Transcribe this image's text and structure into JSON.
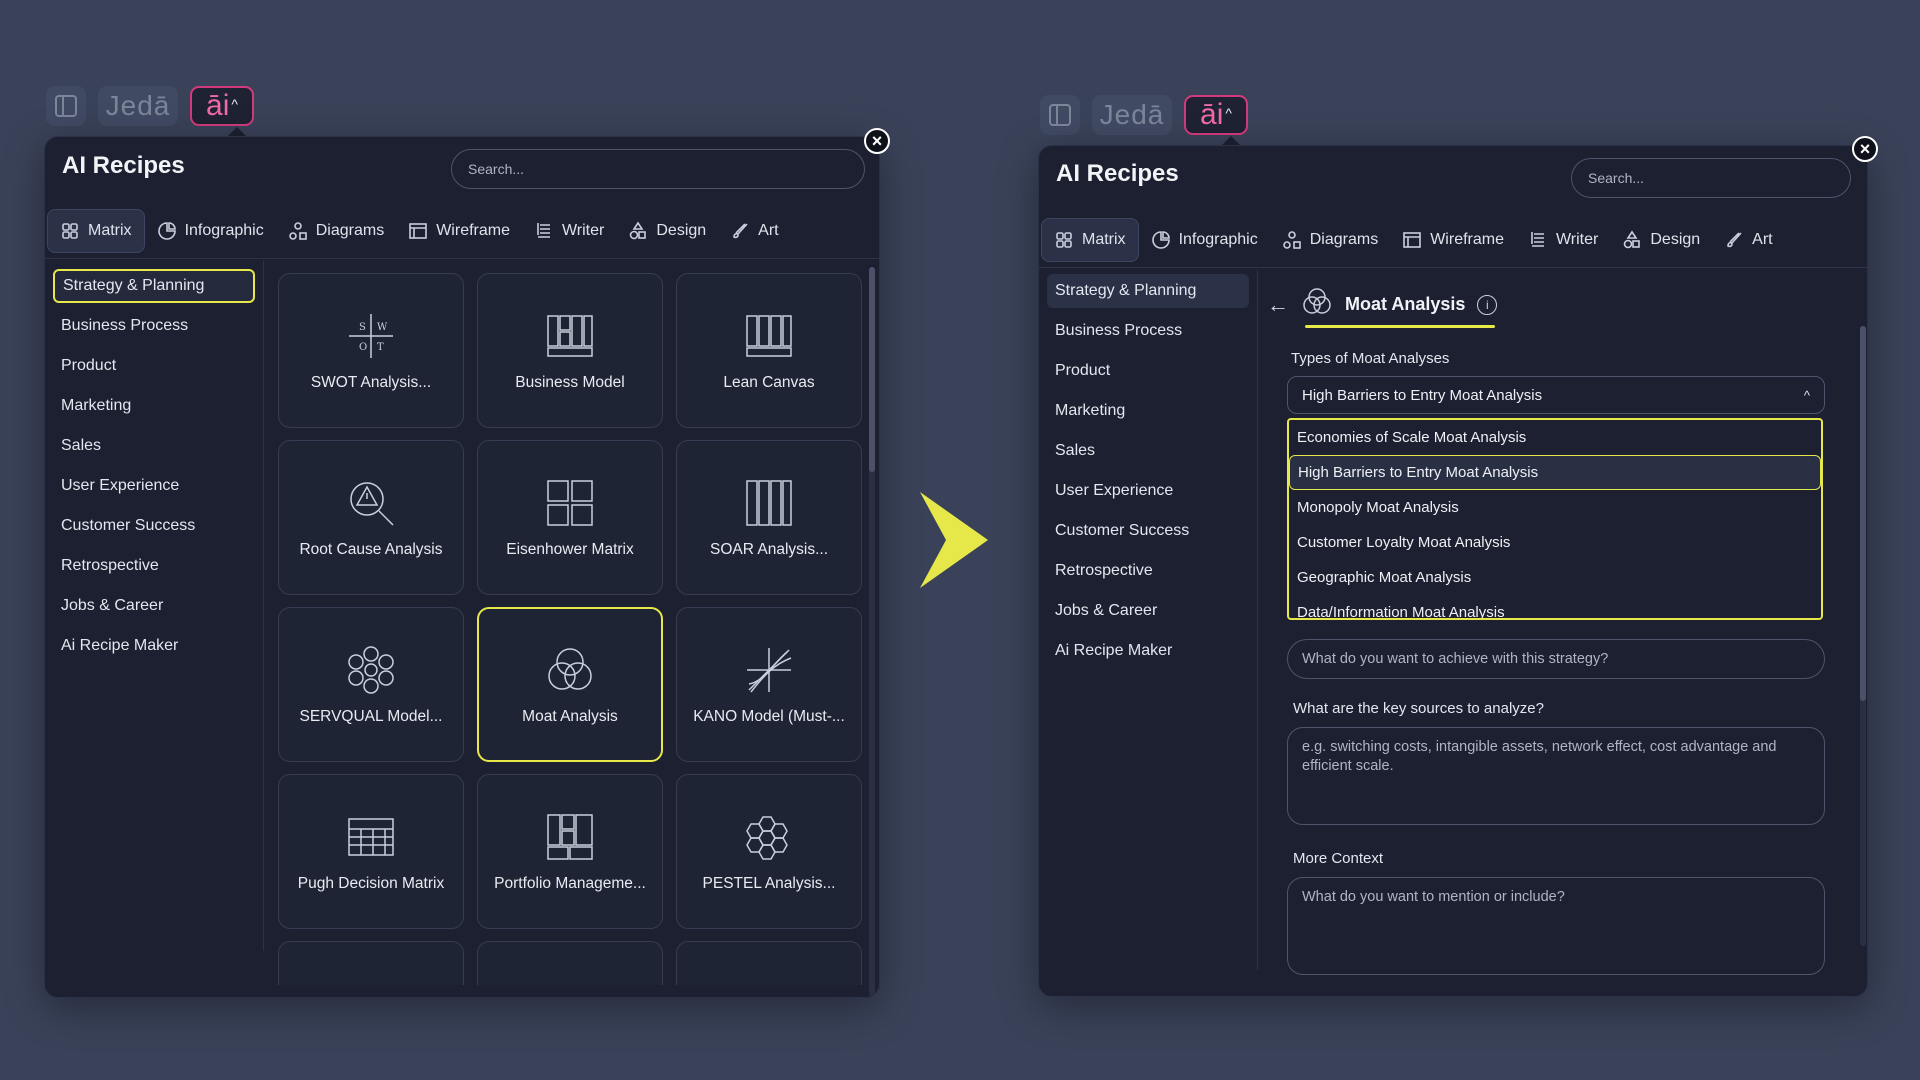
{
  "brand": {
    "jeda": "Jedā",
    "ai": "āi",
    "ai_chevron": "^"
  },
  "left_panel": {
    "title": "AI Recipes",
    "search_placeholder": "Search...",
    "close": "×",
    "tabs": [
      {
        "label": "Matrix",
        "icon": "grid-icon",
        "active": true
      },
      {
        "label": "Infographic",
        "icon": "pie-icon"
      },
      {
        "label": "Diagrams",
        "icon": "diagram-icon"
      },
      {
        "label": "Wireframe",
        "icon": "wireframe-icon"
      },
      {
        "label": "Writer",
        "icon": "list-icon"
      },
      {
        "label": "Design",
        "icon": "shapes-icon"
      },
      {
        "label": "Art",
        "icon": "brush-icon"
      }
    ],
    "sidebar": [
      "Strategy & Planning",
      "Business Process",
      "Product",
      "Marketing",
      "Sales",
      "User Experience",
      "Customer Success",
      "Retrospective",
      "Jobs & Career",
      "Ai Recipe Maker"
    ],
    "cards": [
      {
        "label": "SWOT Analysis...",
        "icon": "swot-icon"
      },
      {
        "label": "Business Model",
        "icon": "business-model-icon"
      },
      {
        "label": "Lean Canvas",
        "icon": "lean-canvas-icon"
      },
      {
        "label": "Root Cause Analysis",
        "icon": "magnifier-warning-icon"
      },
      {
        "label": "Eisenhower Matrix",
        "icon": "quadrant-icon"
      },
      {
        "label": "SOAR Analysis...",
        "icon": "columns-icon"
      },
      {
        "label": "SERVQUAL Model...",
        "icon": "flower-icon"
      },
      {
        "label": "Moat Analysis",
        "icon": "venn-icon"
      },
      {
        "label": "KANO Model (Must-...",
        "icon": "kano-icon"
      },
      {
        "label": "Pugh Decision Matrix",
        "icon": "table-icon"
      },
      {
        "label": "Portfolio Manageme...",
        "icon": "portfolio-icon"
      },
      {
        "label": "PESTEL Analysis...",
        "icon": "hexagons-icon"
      }
    ],
    "swot_letters": [
      "S",
      "W",
      "O",
      "T"
    ]
  },
  "right_panel": {
    "title": "AI Recipes",
    "search_placeholder": "Search...",
    "close": "×",
    "back_arrow": "←",
    "recipe_name": "Moat Analysis",
    "info": "i",
    "types_label": "Types of Moat Analyses",
    "selected_type": "High Barriers to Entry Moat Analysis",
    "select_chevron": "^",
    "options": [
      "Economies of Scale Moat Analysis",
      "High Barriers to Entry Moat Analysis",
      "Monopoly Moat Analysis",
      "Customer Loyalty Moat Analysis",
      "Geographic Moat Analysis",
      "Data/Information Moat Analysis"
    ],
    "goal_placeholder": "What do you want to achieve with this strategy?",
    "sources_label": "What are the key sources to analyze?",
    "sources_placeholder": "e.g. switching costs, intangible assets, network effect, cost advantage and efficient scale.",
    "context_label": "More Context",
    "context_placeholder": "What do you want to mention or include?"
  },
  "colors": {
    "accent": "#e6e84a",
    "brand_pink": "#d33a7d",
    "panel_bg": "#1c2030",
    "page_bg": "#3a4259"
  }
}
